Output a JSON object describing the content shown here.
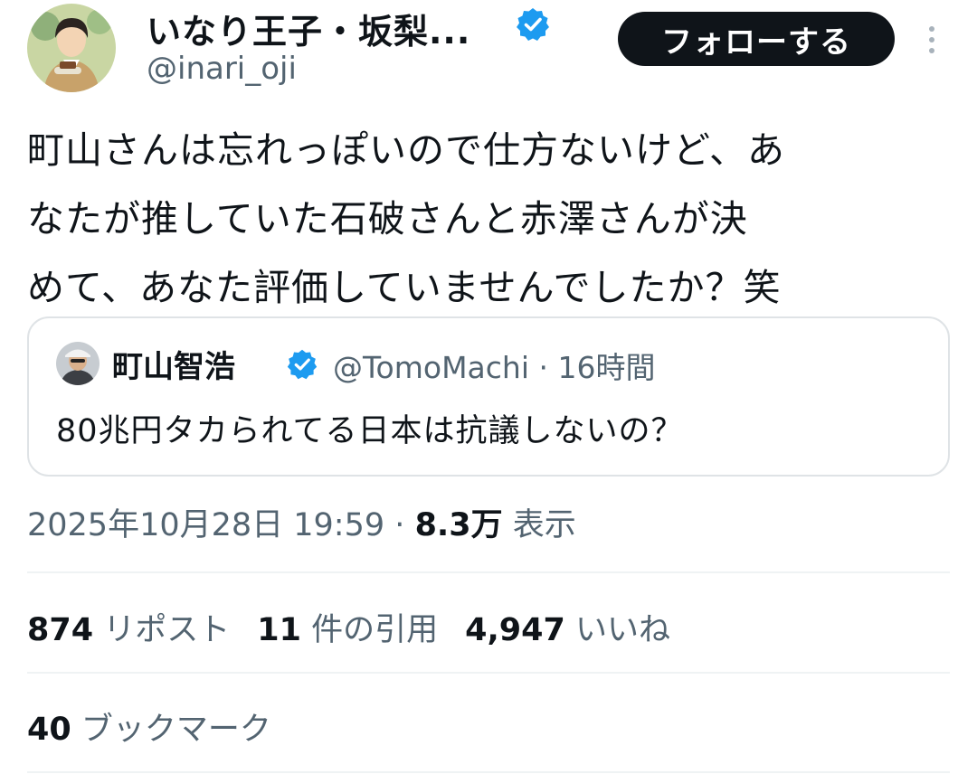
{
  "author": {
    "display_name": "いなり王子・坂梨...",
    "handle": "@inari_oji",
    "verified_color": "#1d9bf0"
  },
  "follow_button": {
    "label": "フォローする"
  },
  "more_menu": {
    "icon": "more-vertical-icon"
  },
  "tweet": {
    "lines": [
      "町山さんは忘れっぽいので仕方ないけど、あ",
      "なたが推していた石破さんと赤澤さんが決",
      "めて、あなた評価していませんでしたか？笑"
    ]
  },
  "quoted_tweet": {
    "display_name": "町山智浩",
    "handle": "@TomoMachi",
    "separator": "·",
    "time": "16時間",
    "text": "80兆円タカられてる日本は抗議しないの？"
  },
  "meta": {
    "datetime": "2025年10月28日 19:59",
    "separator": "·",
    "views_count": "8.3万",
    "views_label": "表示"
  },
  "stats": {
    "reposts_count": "874",
    "reposts_label": "リポスト",
    "quotes_count": "11",
    "quotes_label": "件の引用",
    "likes_count": "4,947",
    "likes_label": "いいね",
    "bookmarks_count": "40",
    "bookmarks_label": "ブックマーク"
  }
}
